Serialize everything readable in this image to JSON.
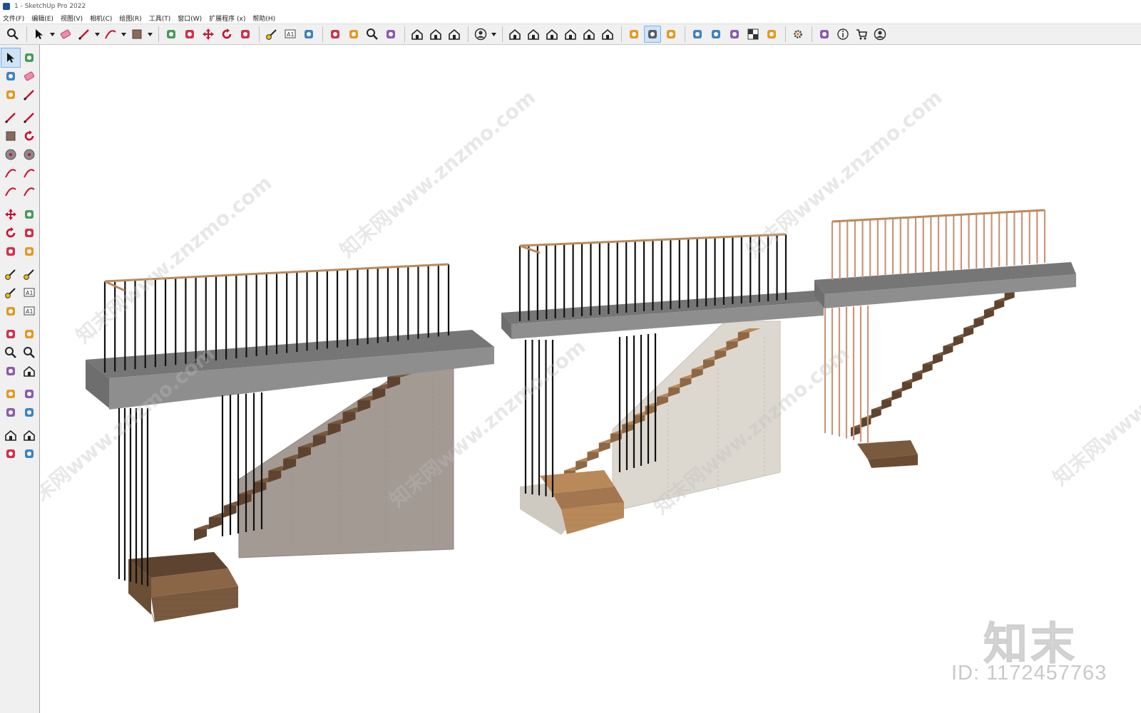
{
  "window": {
    "title": "1 - SketchUp Pro 2022"
  },
  "menu": {
    "items": [
      "文件(F)",
      "编辑(E)",
      "视图(V)",
      "相机(C)",
      "绘图(R)",
      "工具(T)",
      "窗口(W)",
      "扩展程序 (x)",
      "帮助(H)"
    ]
  },
  "toolbar": {
    "groups": [
      [
        "search-icon"
      ],
      [
        "select-icon",
        "eraser-icon",
        "pencil-line-icon",
        "arc-icon",
        "rectangle-icon"
      ],
      [
        "push-pull-icon",
        "follow-me-icon",
        "move-icon",
        "rotate-icon",
        "scale-icon"
      ],
      [
        "tape-measure-icon",
        "text-icon",
        "paint-bucket-icon"
      ],
      [
        "orbit-icon",
        "pan-icon",
        "zoom-icon",
        "zoom-extents-icon"
      ],
      [
        "warehouse-icon",
        "extension-warehouse-icon",
        "layout-icon"
      ],
      [
        "user-account-icon"
      ],
      [
        "iso-view-icon",
        "top-view-icon",
        "front-view-icon",
        "right-view-icon",
        "back-view-icon",
        "left-view-icon"
      ],
      [
        "solid-tools-icon",
        "section-plane-icon",
        "camera-icon"
      ],
      [
        "add-location-icon",
        "shield-icon",
        "sandbox-icon",
        "checker-icon",
        "cloud-upload-icon"
      ],
      [
        "settings-icon"
      ],
      [
        "scenes-icon",
        "info-icon",
        "cart-icon",
        "profile-icon"
      ]
    ],
    "active": "section-plane-icon"
  },
  "left_toolbar": {
    "rows": [
      [
        "select-icon",
        "orbit-small-icon"
      ],
      [
        "paint-bucket-icon",
        "eraser-icon"
      ],
      [
        "component-icon",
        "pencil-paint-icon"
      ],
      [
        "gap"
      ],
      [
        "line-icon",
        "freehand-icon"
      ],
      [
        "rectangle-icon",
        "rotated-rect-icon"
      ],
      [
        "circle-icon",
        "polygon-icon"
      ],
      [
        "arc-icon",
        "arc-2pt-icon"
      ],
      [
        "arc-3pt-icon",
        "pie-icon"
      ],
      [
        "gap"
      ],
      [
        "move-icon",
        "push-pull-icon"
      ],
      [
        "rotate-icon",
        "follow-me-icon"
      ],
      [
        "scale-icon",
        "offset-icon"
      ],
      [
        "gap"
      ],
      [
        "tape-measure-icon",
        "dimension-icon"
      ],
      [
        "protractor-icon",
        "text-icon"
      ],
      [
        "axes-icon",
        "3d-text-icon"
      ],
      [
        "gap"
      ],
      [
        "orbit-icon",
        "pan-icon"
      ],
      [
        "zoom-icon",
        "zoom-window-icon"
      ],
      [
        "zoom-extents-icon",
        "previous-view-icon"
      ],
      [
        "gap"
      ],
      [
        "position-camera-icon",
        "look-around-icon"
      ],
      [
        "walk-icon",
        "section-icon"
      ],
      [
        "gap"
      ],
      [
        "warehouse-icon",
        "extension-warehouse-icon"
      ],
      [
        "layers-icon",
        "share-icon"
      ]
    ],
    "active": "select-icon"
  },
  "colors": {
    "slab_top": "#767676",
    "slab_front": "#8e8e8e",
    "wood_dark": "#7a5a3e",
    "wood_light": "#b9895a",
    "wall_1": "#a49a94",
    "wall_2": "#ddd8cf",
    "handrail": "#b88a5e",
    "baluster_black": "#111111",
    "baluster_copper": "#c9967a"
  },
  "watermark": {
    "text": "知末网www.znzmo.com",
    "logo": "知末",
    "id": "ID: 1172457763"
  }
}
